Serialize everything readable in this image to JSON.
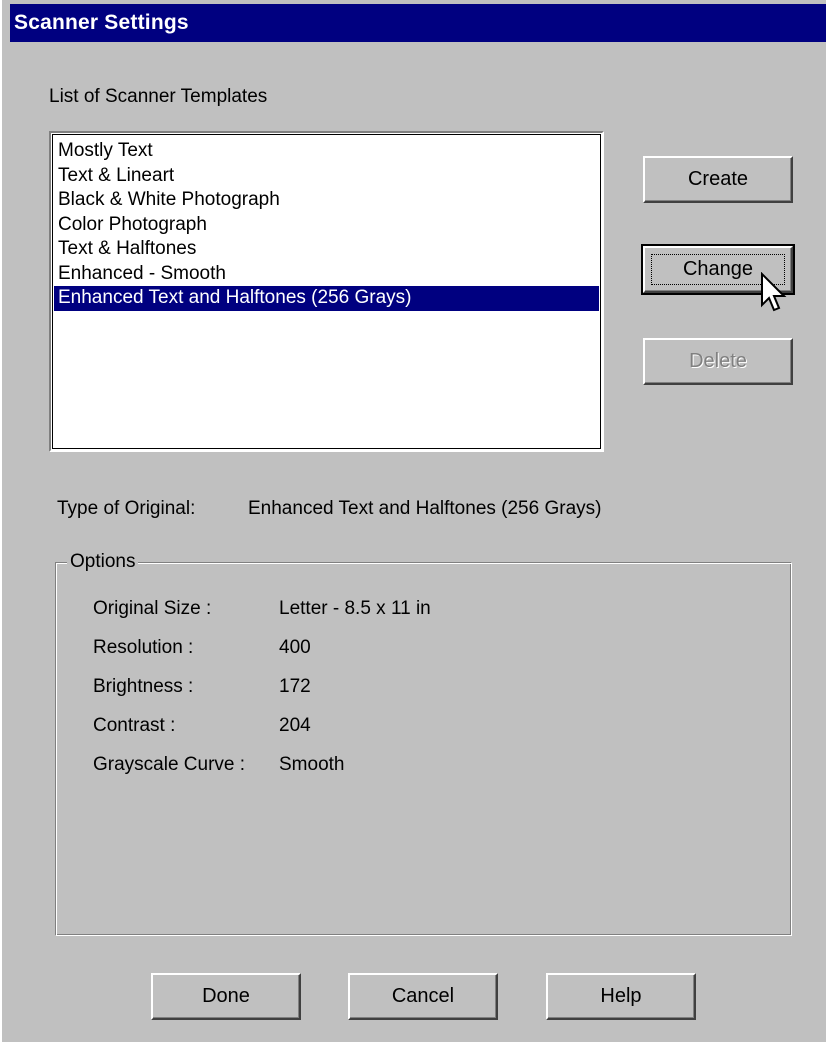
{
  "window": {
    "title": "Scanner Settings"
  },
  "templates": {
    "label": "List of Scanner Templates",
    "items": [
      {
        "label": "Mostly Text",
        "selected": false
      },
      {
        "label": "Text & Lineart",
        "selected": false
      },
      {
        "label": "Black & White Photograph",
        "selected": false
      },
      {
        "label": "Color Photograph",
        "selected": false
      },
      {
        "label": "Text & Halftones",
        "selected": false
      },
      {
        "label": "Enhanced - Smooth",
        "selected": false
      },
      {
        "label": "Enhanced Text and Halftones (256 Grays)",
        "selected": true
      }
    ],
    "buttons": {
      "create": "Create",
      "change": "Change",
      "delete": "Delete"
    }
  },
  "original": {
    "label": "Type of Original:",
    "value": "Enhanced Text and Halftones (256 Grays)"
  },
  "options": {
    "legend": "Options",
    "rows": [
      {
        "label": "Original Size :",
        "value": "Letter - 8.5 x 11 in"
      },
      {
        "label": "Resolution :",
        "value": "400"
      },
      {
        "label": "Brightness :",
        "value": "172"
      },
      {
        "label": "Contrast :",
        "value": "204"
      },
      {
        "label": "Grayscale Curve :",
        "value": "Smooth"
      }
    ]
  },
  "footer": {
    "done": "Done",
    "cancel": "Cancel",
    "help": "Help"
  },
  "colors": {
    "titlebar": "#000080",
    "selection": "#000080",
    "face": "#c0c0c0"
  },
  "icons": {
    "cursor": "arrow-pointer-icon"
  }
}
